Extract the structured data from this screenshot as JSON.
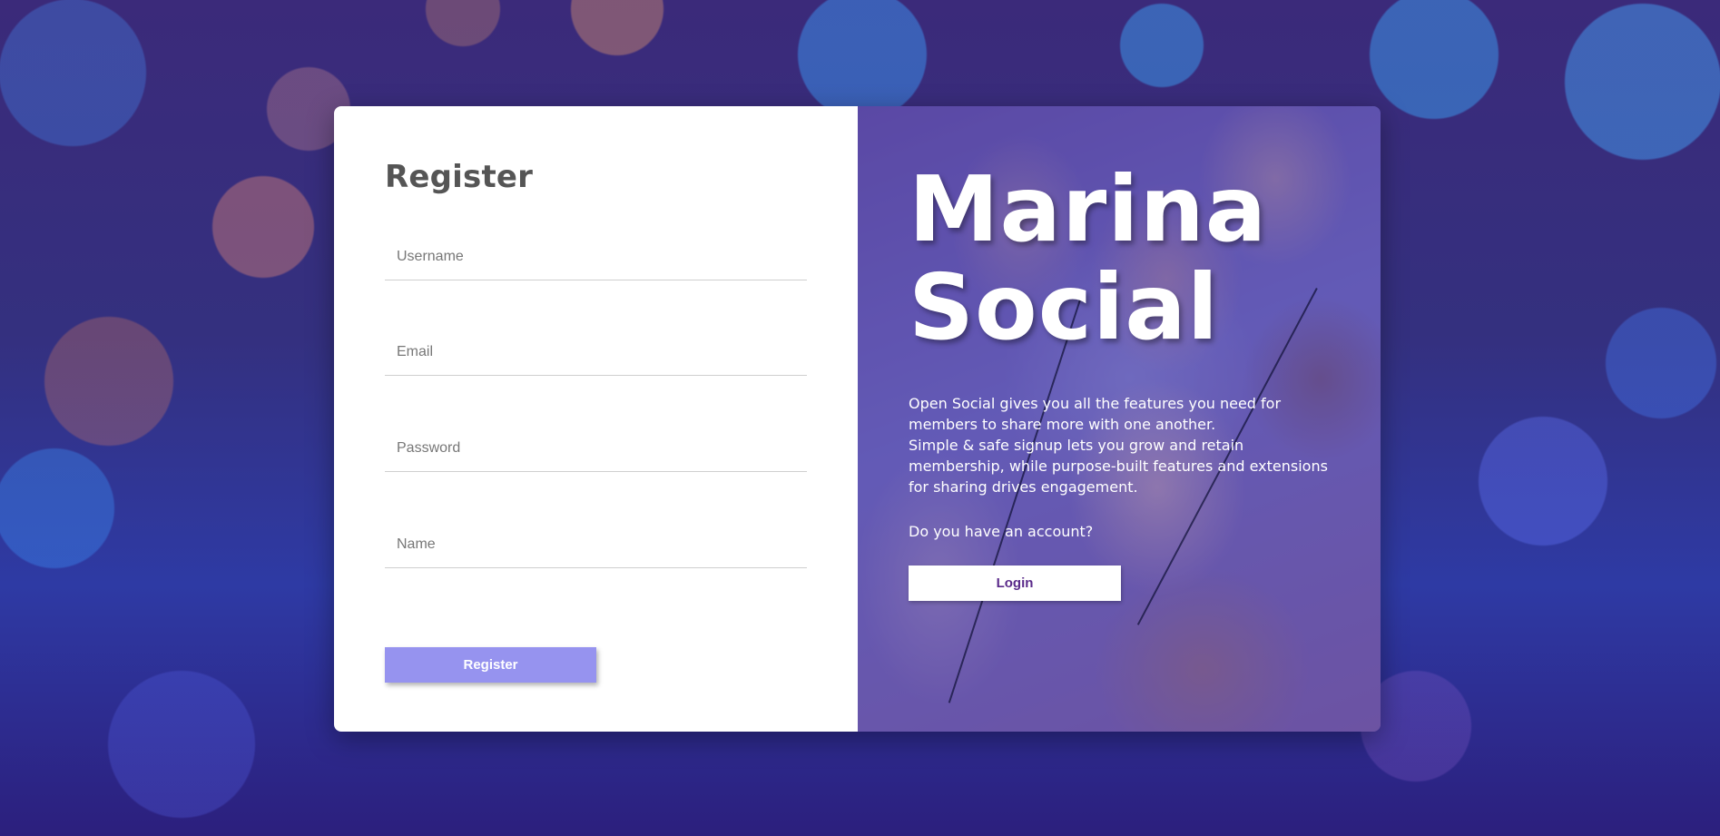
{
  "register": {
    "title": "Register",
    "fields": {
      "username_placeholder": "Username",
      "email_placeholder": "Email",
      "password_placeholder": "Password",
      "name_placeholder": "Name"
    },
    "submit_label": "Register"
  },
  "hero": {
    "title_line1": "Marina",
    "title_line2": "Social",
    "description_line1": "Open Social gives you all the features you need for members to share more with one another.",
    "description_line2": "Simple & safe signup lets you grow and retain membership, while purpose-built features and extensions for sharing drives engagement.",
    "question": "Do you have an account?",
    "login_label": "Login"
  },
  "colors": {
    "register_button": "#9693ef",
    "login_text": "#5a2a8a",
    "heading_text": "#555555",
    "background": "#33307f"
  }
}
